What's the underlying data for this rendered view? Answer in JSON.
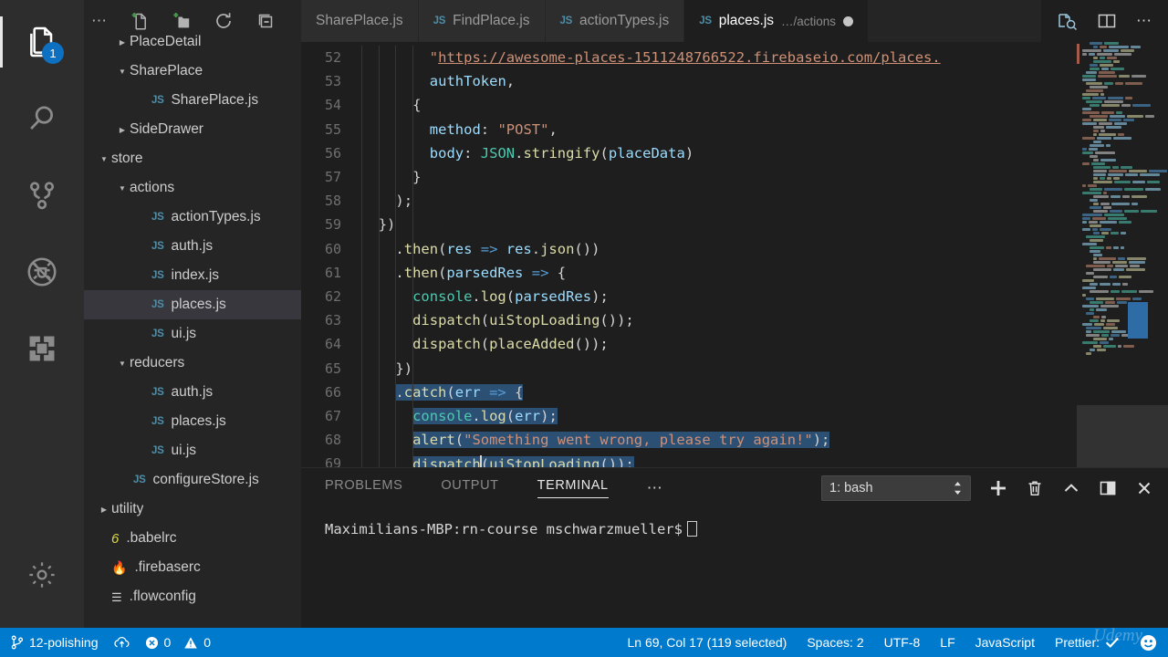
{
  "activity_bar": {
    "items": [
      {
        "name": "explorer",
        "icon": "files-icon",
        "badge": "1",
        "active": true
      },
      {
        "name": "search",
        "icon": "search-icon",
        "badge": "",
        "active": false
      },
      {
        "name": "source-control",
        "icon": "source-control-icon",
        "badge": "",
        "active": false
      },
      {
        "name": "debug",
        "icon": "debug-no-bug-icon",
        "badge": "",
        "active": false
      },
      {
        "name": "extensions",
        "icon": "extensions-icon",
        "badge": "",
        "active": false
      }
    ],
    "manage": {
      "name": "manage",
      "icon": "gear-icon"
    }
  },
  "sidebar": {
    "toolbar": [
      {
        "label": "More Actions",
        "icon": "ellipsis-icon"
      },
      {
        "label": "New File",
        "icon": "new-file-icon"
      },
      {
        "label": "New Folder",
        "icon": "new-folder-icon"
      },
      {
        "label": "Refresh Explorer",
        "icon": "refresh-icon"
      },
      {
        "label": "Collapse Folders in Explorer",
        "icon": "collapse-all-icon"
      }
    ],
    "tree": [
      {
        "label": "PlaceDetail",
        "kind": "folder",
        "expanded": false,
        "indent": 1,
        "selected": false,
        "icon": ""
      },
      {
        "label": "SharePlace",
        "kind": "folder",
        "expanded": true,
        "indent": 1,
        "selected": false,
        "icon": ""
      },
      {
        "label": "SharePlace.js",
        "kind": "file",
        "expanded": false,
        "indent": 2,
        "selected": false,
        "icon": "js"
      },
      {
        "label": "SideDrawer",
        "kind": "folder",
        "expanded": false,
        "indent": 1,
        "selected": false,
        "icon": ""
      },
      {
        "label": "store",
        "kind": "folder",
        "expanded": true,
        "indent": 0,
        "selected": false,
        "icon": ""
      },
      {
        "label": "actions",
        "kind": "folder",
        "expanded": true,
        "indent": 1,
        "selected": false,
        "icon": ""
      },
      {
        "label": "actionTypes.js",
        "kind": "file",
        "expanded": false,
        "indent": 2,
        "selected": false,
        "icon": "js"
      },
      {
        "label": "auth.js",
        "kind": "file",
        "expanded": false,
        "indent": 2,
        "selected": false,
        "icon": "js"
      },
      {
        "label": "index.js",
        "kind": "file",
        "expanded": false,
        "indent": 2,
        "selected": false,
        "icon": "js"
      },
      {
        "label": "places.js",
        "kind": "file",
        "expanded": false,
        "indent": 2,
        "selected": true,
        "icon": "js"
      },
      {
        "label": "ui.js",
        "kind": "file",
        "expanded": false,
        "indent": 2,
        "selected": false,
        "icon": "js"
      },
      {
        "label": "reducers",
        "kind": "folder",
        "expanded": true,
        "indent": 1,
        "selected": false,
        "icon": ""
      },
      {
        "label": "auth.js",
        "kind": "file",
        "expanded": false,
        "indent": 2,
        "selected": false,
        "icon": "js"
      },
      {
        "label": "places.js",
        "kind": "file",
        "expanded": false,
        "indent": 2,
        "selected": false,
        "icon": "js"
      },
      {
        "label": "ui.js",
        "kind": "file",
        "expanded": false,
        "indent": 2,
        "selected": false,
        "icon": "js"
      },
      {
        "label": "configureStore.js",
        "kind": "file",
        "expanded": false,
        "indent": 1,
        "selected": false,
        "icon": "js"
      },
      {
        "label": "utility",
        "kind": "folder",
        "expanded": false,
        "indent": 0,
        "selected": false,
        "icon": ""
      },
      {
        "label": ".babelrc",
        "kind": "file",
        "expanded": false,
        "indent": 0,
        "selected": false,
        "icon": "babel"
      },
      {
        "label": ".firebaserc",
        "kind": "file",
        "expanded": false,
        "indent": 0,
        "selected": false,
        "icon": "firebase"
      },
      {
        "label": ".flowconfig",
        "kind": "file",
        "expanded": false,
        "indent": 0,
        "selected": false,
        "icon": "flow"
      }
    ]
  },
  "tabs": {
    "items": [
      {
        "label": "SharePlace.js",
        "icon": "",
        "active": false,
        "dirty": false,
        "path": ""
      },
      {
        "label": "FindPlace.js",
        "icon": "js",
        "active": false,
        "dirty": false,
        "path": ""
      },
      {
        "label": "actionTypes.js",
        "icon": "js",
        "active": false,
        "dirty": false,
        "path": ""
      },
      {
        "label": "places.js",
        "icon": "js",
        "active": true,
        "dirty": true,
        "path": "…/actions"
      }
    ],
    "actions": [
      {
        "name": "open-changes-icon",
        "label": "Open Changes"
      },
      {
        "name": "split-editor-icon",
        "label": "Split Editor"
      },
      {
        "name": "more-actions-icon",
        "label": "More Actions"
      }
    ]
  },
  "editor": {
    "first_line_number": 52,
    "lines": [
      {
        "n": 52,
        "indent": 4,
        "tokens": [
          {
            "t": "\"",
            "c": "t-str"
          },
          {
            "t": "https://awesome-places-1511248766522.firebaseio.com/places.",
            "c": "t-url"
          }
        ]
      },
      {
        "n": 53,
        "indent": 4,
        "tokens": [
          {
            "t": "authToken",
            "c": "t-key"
          },
          {
            "t": ",",
            "c": "t-punc"
          }
        ]
      },
      {
        "n": 54,
        "indent": 3,
        "tokens": [
          {
            "t": "{",
            "c": "t-punc"
          }
        ]
      },
      {
        "n": 55,
        "indent": 4,
        "tokens": [
          {
            "t": "method",
            "c": "t-key"
          },
          {
            "t": ": ",
            "c": "t-punc"
          },
          {
            "t": "\"POST\"",
            "c": "t-str"
          },
          {
            "t": ",",
            "c": "t-punc"
          }
        ]
      },
      {
        "n": 56,
        "indent": 4,
        "tokens": [
          {
            "t": "body",
            "c": "t-key"
          },
          {
            "t": ": ",
            "c": "t-punc"
          },
          {
            "t": "JSON",
            "c": "t-cls"
          },
          {
            "t": ".",
            "c": "t-punc"
          },
          {
            "t": "stringify",
            "c": "t-fn"
          },
          {
            "t": "(",
            "c": "t-punc"
          },
          {
            "t": "placeData",
            "c": "t-key"
          },
          {
            "t": ")",
            "c": "t-punc"
          }
        ]
      },
      {
        "n": 57,
        "indent": 3,
        "tokens": [
          {
            "t": "}",
            "c": "t-punc"
          }
        ]
      },
      {
        "n": 58,
        "indent": 2,
        "tokens": [
          {
            "t": ");",
            "c": "t-punc"
          }
        ]
      },
      {
        "n": 59,
        "indent": 1,
        "tokens": [
          {
            "t": "})",
            "c": "t-punc"
          }
        ]
      },
      {
        "n": 60,
        "indent": 2,
        "tokens": [
          {
            "t": ".",
            "c": "t-punc"
          },
          {
            "t": "then",
            "c": "t-fn"
          },
          {
            "t": "(",
            "c": "t-punc"
          },
          {
            "t": "res ",
            "c": "t-key"
          },
          {
            "t": "=>",
            "c": "t-op"
          },
          {
            "t": " res",
            "c": "t-key"
          },
          {
            "t": ".",
            "c": "t-punc"
          },
          {
            "t": "json",
            "c": "t-fn"
          },
          {
            "t": "())",
            "c": "t-punc"
          }
        ]
      },
      {
        "n": 61,
        "indent": 2,
        "tokens": [
          {
            "t": ".",
            "c": "t-punc"
          },
          {
            "t": "then",
            "c": "t-fn"
          },
          {
            "t": "(",
            "c": "t-punc"
          },
          {
            "t": "parsedRes ",
            "c": "t-key"
          },
          {
            "t": "=>",
            "c": "t-op"
          },
          {
            "t": " {",
            "c": "t-punc"
          }
        ]
      },
      {
        "n": 62,
        "indent": 3,
        "tokens": [
          {
            "t": "console",
            "c": "t-cls"
          },
          {
            "t": ".",
            "c": "t-punc"
          },
          {
            "t": "log",
            "c": "t-fn"
          },
          {
            "t": "(",
            "c": "t-punc"
          },
          {
            "t": "parsedRes",
            "c": "t-key"
          },
          {
            "t": ");",
            "c": "t-punc"
          }
        ]
      },
      {
        "n": 63,
        "indent": 3,
        "tokens": [
          {
            "t": "dispatch",
            "c": "t-fn"
          },
          {
            "t": "(",
            "c": "t-punc"
          },
          {
            "t": "uiStopLoading",
            "c": "t-fn"
          },
          {
            "t": "());",
            "c": "t-punc"
          }
        ]
      },
      {
        "n": 64,
        "indent": 3,
        "tokens": [
          {
            "t": "dispatch",
            "c": "t-fn"
          },
          {
            "t": "(",
            "c": "t-punc"
          },
          {
            "t": "placeAdded",
            "c": "t-fn"
          },
          {
            "t": "());",
            "c": "t-punc"
          }
        ]
      },
      {
        "n": 65,
        "indent": 2,
        "tokens": [
          {
            "t": "})",
            "c": "t-punc"
          }
        ]
      },
      {
        "n": 66,
        "indent": 2,
        "selected": true,
        "tokens": [
          {
            "t": ".",
            "c": "t-punc"
          },
          {
            "t": "catch",
            "c": "t-fn"
          },
          {
            "t": "(",
            "c": "t-punc"
          },
          {
            "t": "err ",
            "c": "t-key"
          },
          {
            "t": "=>",
            "c": "t-op"
          },
          {
            "t": " {",
            "c": "t-punc"
          }
        ]
      },
      {
        "n": 67,
        "indent": 3,
        "selected": true,
        "tokens": [
          {
            "t": "console",
            "c": "t-cls"
          },
          {
            "t": ".",
            "c": "t-punc"
          },
          {
            "t": "log",
            "c": "t-fn"
          },
          {
            "t": "(",
            "c": "t-punc"
          },
          {
            "t": "err",
            "c": "t-key"
          },
          {
            "t": ");",
            "c": "t-punc"
          }
        ]
      },
      {
        "n": 68,
        "indent": 3,
        "selected": true,
        "tokens": [
          {
            "t": "alert",
            "c": "t-fn"
          },
          {
            "t": "(",
            "c": "t-punc"
          },
          {
            "t": "\"Something went wrong, please try again!\"",
            "c": "t-str"
          },
          {
            "t": ");",
            "c": "t-punc"
          }
        ]
      },
      {
        "n": 69,
        "indent": 3,
        "selected": true,
        "cursor_after": "dispatch",
        "tokens": [
          {
            "t": "dispatch",
            "c": "t-fn"
          },
          {
            "t": "(",
            "c": "t-punc"
          },
          {
            "t": "uiStopLoading",
            "c": "t-fn"
          },
          {
            "t": "());",
            "c": "t-punc"
          }
        ]
      }
    ]
  },
  "panel": {
    "tabs": [
      {
        "label": "PROBLEMS",
        "active": false
      },
      {
        "label": "OUTPUT",
        "active": false
      },
      {
        "label": "TERMINAL",
        "active": true
      }
    ],
    "more_label": "…",
    "terminal_select": "1: bash",
    "actions": [
      {
        "name": "new-terminal-icon",
        "label": "New Terminal"
      },
      {
        "name": "kill-terminal-icon",
        "label": "Kill Terminal"
      },
      {
        "name": "maximize-panel-icon",
        "label": "Maximize Panel Size"
      },
      {
        "name": "split-terminal-icon",
        "label": "Split Terminal"
      },
      {
        "name": "close-panel-icon",
        "label": "Close Panel"
      }
    ],
    "terminal_text": "Maximilians-MBP:rn-course mschwarzmueller$"
  },
  "status_bar": {
    "branch": "12-polishing",
    "sync_icon": "sync-cloud-icon",
    "errors": "0",
    "warnings": "0",
    "position": "Ln 69, Col 17 (119 selected)",
    "indentation": "Spaces: 2",
    "encoding": "UTF-8",
    "eol": "LF",
    "language": "JavaScript",
    "prettier": "Prettier:",
    "feedback_icon": "smiley-icon",
    "watermark": "Udemy"
  },
  "colors": {
    "accent": "#007acc",
    "editor_bg": "#1e1e1e",
    "sidebar_bg": "#252526",
    "activitybar_bg": "#2d2d2d",
    "selection": "#2c4f74",
    "badge": "#0e70c0"
  }
}
